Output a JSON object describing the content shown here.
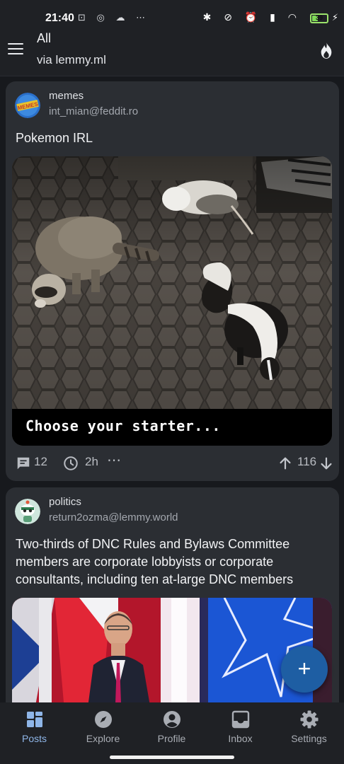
{
  "status_bar": {
    "time": "21:40",
    "left_icons": [
      "sim-icon",
      "threads-icon",
      "cloud-icon",
      "more-dots-icon"
    ],
    "right_icons": [
      "bluetooth-icon",
      "mute-icon",
      "alarm-icon",
      "signal-icon",
      "wifi-icon"
    ],
    "battery": {
      "text": "39",
      "level": 0.39
    },
    "colors": {
      "battery": "#7ed957"
    }
  },
  "app_bar": {
    "title": "All",
    "subtitle": "via lemmy.ml",
    "menu_icon": "menu-icon",
    "action_icon": "fire-icon"
  },
  "posts": [
    {
      "community": "memes",
      "author": "int_mian@feddit.ro",
      "title": "Pokemon IRL",
      "image_caption": "Choose your starter...",
      "comments": "12",
      "age": "2h",
      "score": "116",
      "icons": [
        "comment-icon",
        "clock-icon",
        "more-icon",
        "upvote-icon",
        "downvote-icon"
      ]
    },
    {
      "community": "politics",
      "author": "return2ozma@lemmy.world",
      "title": "Two-thirds of DNC Rules and Bylaws Committee members are corporate lobbyists or corporate consultants, including ten at-large DNC members"
    }
  ],
  "fab": {
    "label": "+",
    "color": "#1e5ea3"
  },
  "bottom_nav": {
    "active": "Posts",
    "items": [
      {
        "label": "Posts",
        "icon": "posts-icon"
      },
      {
        "label": "Explore",
        "icon": "compass-icon"
      },
      {
        "label": "Profile",
        "icon": "profile-icon"
      },
      {
        "label": "Inbox",
        "icon": "inbox-icon"
      },
      {
        "label": "Settings",
        "icon": "settings-icon"
      }
    ],
    "colors": {
      "active": "#8fb6e8",
      "inactive": "#a9adb4"
    }
  }
}
